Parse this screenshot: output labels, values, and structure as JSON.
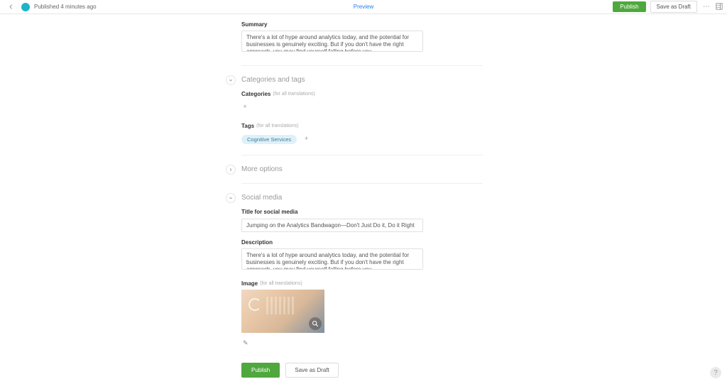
{
  "header": {
    "status": "Published 4 minutes ago",
    "preview": "Preview",
    "publish": "Publish",
    "save_draft": "Save as Draft"
  },
  "summary": {
    "label": "Summary",
    "value": "There's a lot of hype around analytics today, and the potential for businesses is genuinely exciting. But if you don't have the right approach, you may find yourself falling before you"
  },
  "sections": {
    "categories_and_tags": "Categories and tags",
    "more_options": "More options",
    "social_media": "Social media"
  },
  "categories": {
    "label": "Categories",
    "hint": "(for all translations)"
  },
  "tags": {
    "label": "Tags",
    "hint": "(for all translations)",
    "items": [
      "Cognitive Services"
    ]
  },
  "social": {
    "title_label": "Title for social media",
    "title_value": "Jumping on the Analytics Bandwagon—Don't Just Do it, Do it Right",
    "description_label": "Description",
    "description_value": "There's a lot of hype around analytics today, and the potential for businesses is genuinely exciting. But if you don't have the right approach, you may find yourself falling before you",
    "image_label": "Image",
    "image_hint": "(for all translations)"
  },
  "footer": {
    "publish": "Publish",
    "save_draft": "Save as Draft"
  }
}
